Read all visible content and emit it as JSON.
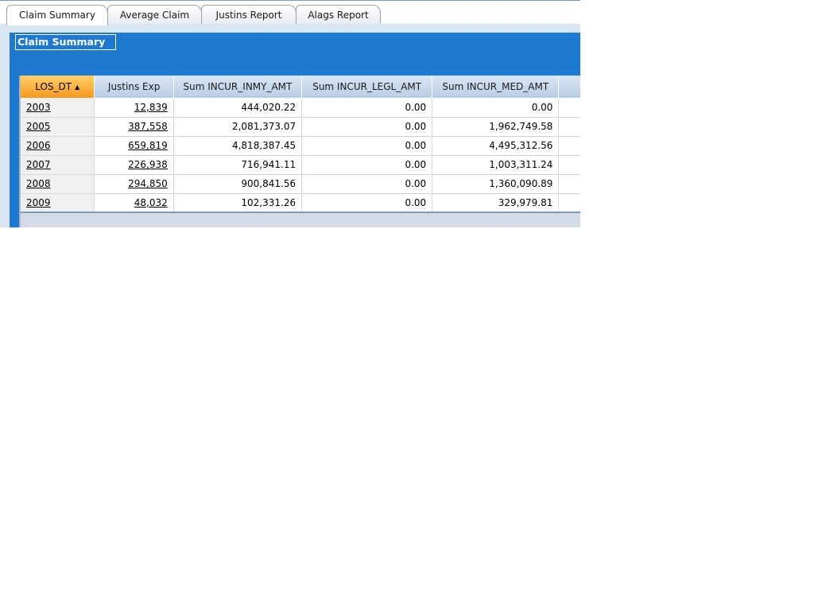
{
  "tabs": [
    {
      "label": "Claim Summary",
      "active": true
    },
    {
      "label": "Average Claim",
      "active": false
    },
    {
      "label": "Justins Report",
      "active": false
    },
    {
      "label": "Alags Report",
      "active": false
    }
  ],
  "panel": {
    "title": "Claim Summary"
  },
  "table": {
    "columns": [
      "LOS_DT",
      "Justins Exp",
      "Sum INCUR_INMY_AMT",
      "Sum INCUR_LEGL_AMT",
      "Sum INCUR_MED_AMT"
    ],
    "sorted_column": "LOS_DT",
    "sort_direction": "ascending",
    "rows": [
      [
        "2003",
        "12,839",
        "444,020.22",
        "0.00",
        "0.00"
      ],
      [
        "2005",
        "387,558",
        "2,081,373.07",
        "0.00",
        "1,962,749.58"
      ],
      [
        "2006",
        "659,819",
        "4,818,387.45",
        "0.00",
        "4,495,312.56"
      ],
      [
        "2007",
        "226,938",
        "716,941.11",
        "0.00",
        "1,003,311.24"
      ],
      [
        "2008",
        "294,850",
        "900,841.56",
        "0.00",
        "1,360,090.89"
      ],
      [
        "2009",
        "48,032",
        "102,331.26",
        "0.00",
        "329,979.81"
      ]
    ]
  },
  "colors": {
    "panel": "#1e7ad1",
    "sorted_header": "#f79a1d",
    "header": "#c8d8ec"
  }
}
